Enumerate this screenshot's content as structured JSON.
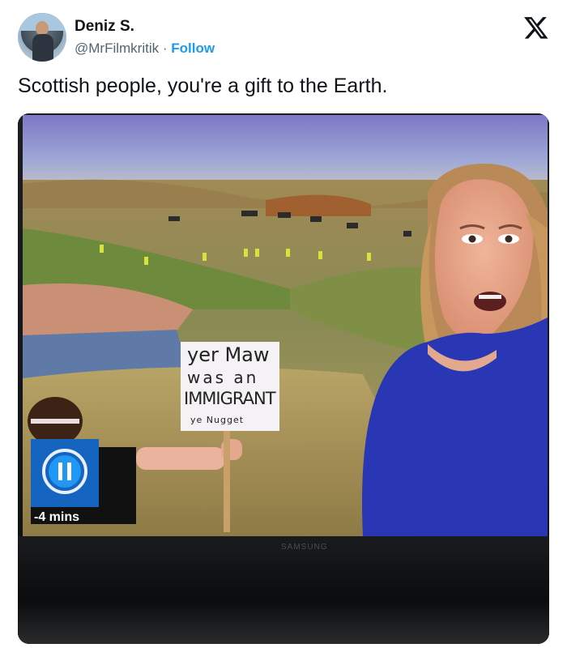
{
  "tweet": {
    "display_name": "Deniz S.",
    "handle": "@MrFilmkritik",
    "separator": "·",
    "follow_label": "Follow",
    "text": "Scottish people, you're a gift to the Earth."
  },
  "media": {
    "sign": {
      "line1": "yer Maw",
      "line2": "was an",
      "line3": "IMMIGRANT",
      "line4": "ye Nugget"
    },
    "overlay": {
      "time_label": "-4 mins"
    },
    "tv_brand": "SAMSUNG"
  },
  "colors": {
    "follow": "#1d9bf0",
    "handle": "#536471",
    "text": "#0f1419",
    "overlay_blue": "#1565c0",
    "dress_blue": "#2a37b5"
  },
  "icons": [
    "x-logo-icon",
    "pause-icon"
  ]
}
